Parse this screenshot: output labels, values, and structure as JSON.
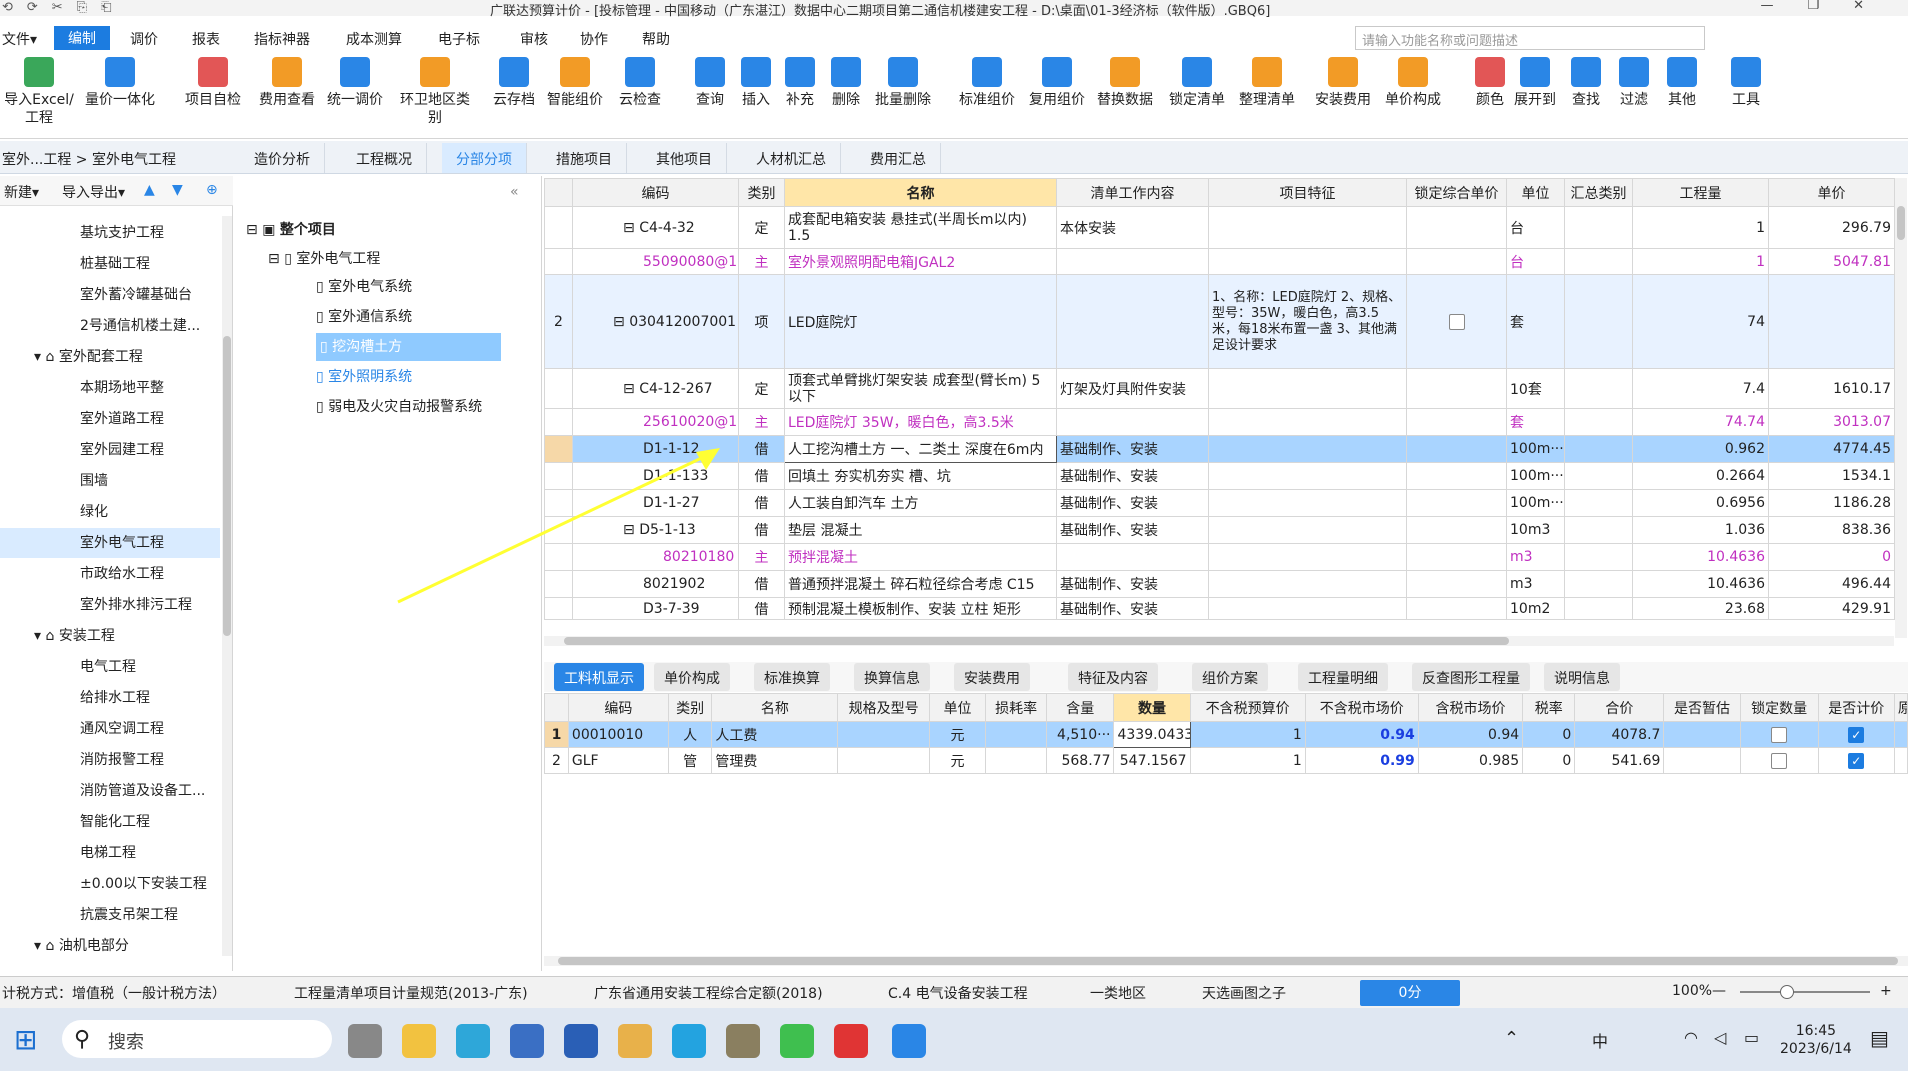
{
  "window": {
    "title": "广联达预算计价 - [投标管理 - 中国移动（广东湛江）数据中心二期项目第二通信机楼建安工程 - D:\\桌面\\01-3经济标（软件版）.GBQ6]"
  },
  "menus": [
    "文件▾",
    "编制",
    "调价",
    "报表",
    "指标神器",
    "成本测算",
    "电子标",
    "审核",
    "协作",
    "帮助"
  ],
  "search": {
    "placeholder": "请输入功能名称或问题描述"
  },
  "ribbon": [
    "导入Excel/工程",
    "量价一体化",
    "项目自检",
    "费用查看",
    "统一调价",
    "环卫地区类别",
    "云存档",
    "智能组价",
    "云检查",
    "查询",
    "插入",
    "补充",
    "删除",
    "批量删除",
    "标准组价",
    "复用组价",
    "替换数据",
    "锁定清单",
    "整理清单",
    "安装费用",
    "单价构成",
    "颜色",
    "展开到",
    "查找",
    "过滤",
    "其他",
    "工具"
  ],
  "breadcrumb": "室外...工程 > 室外电气工程",
  "tabs": [
    "造价分析",
    "工程概况",
    "分部分项",
    "措施项目",
    "其他项目",
    "人材机汇总",
    "费用汇总"
  ],
  "left": {
    "tools": [
      "新建▾",
      "导入导出▾"
    ],
    "items": [
      "基坑支护工程",
      "桩基础工程",
      "室外蓄冷罐基础台",
      "2号通信机楼土建...",
      "室外配套工程",
      "本期场地平整",
      "室外道路工程",
      "室外园建工程",
      "围墙",
      "绿化",
      "室外电气工程",
      "市政给水工程",
      "室外排水排污工程",
      "安装工程",
      "电气工程",
      "给排水工程",
      "通风空调工程",
      "消防报警工程",
      "消防管道及设备工...",
      "智能化工程",
      "电梯工程",
      "±0.00以下安装工程",
      "抗震支吊架工程",
      "油机电部分"
    ]
  },
  "tree": {
    "root": "整个项目",
    "node": "室外电气工程",
    "children": [
      "室外电气系统",
      "室外通信系统",
      "挖沟槽土方",
      "室外照明系统",
      "弱电及火灾自动报警系统"
    ]
  },
  "grid": {
    "headers": [
      "编码",
      "类别",
      "名称",
      "清单工作内容",
      "项目特征",
      "锁定综合单价",
      "单位",
      "汇总类别",
      "工程量",
      "单价"
    ],
    "rows": [
      {
        "no": "",
        "code": "C4-4-32",
        "type": "定",
        "name": "成套配电箱安装 悬挂式(半周长m以内) 1.5",
        "work": "本体安装",
        "feat": "",
        "unit": "台",
        "qty": "1",
        "price": "296.79"
      },
      {
        "no": "",
        "code": "55090080@1",
        "type": "主",
        "name": "室外景观照明配电箱JGAL2",
        "work": "",
        "feat": "",
        "unit": "台",
        "qty": "1",
        "price": "5047.81"
      },
      {
        "no": "2",
        "code": "030412007001",
        "type": "项",
        "name": "LED庭院灯",
        "work": "",
        "feat": "1、名称：LED庭院灯 2、规格、型号：35W，暖白色，高3.5米，每18米布置一盏 3、其他满足设计要求",
        "unit": "套",
        "qty": "74",
        "price": ""
      },
      {
        "no": "",
        "code": "C4-12-267",
        "type": "定",
        "name": "顶套式单臂挑灯架安装 成套型(臂长m) 5以下",
        "work": "灯架及灯具附件安装",
        "feat": "",
        "unit": "10套",
        "qty": "7.4",
        "price": "1610.17"
      },
      {
        "no": "",
        "code": "25610020@1",
        "type": "主",
        "name": "LED庭院灯 35W，暖白色，高3.5米",
        "work": "",
        "feat": "",
        "unit": "套",
        "qty": "74.74",
        "price": "3013.07"
      },
      {
        "no": "",
        "code": "D1-1-12",
        "type": "借",
        "name": "人工挖沟槽土方 一、二类土 深度在6m内",
        "work": "基础制作、安装",
        "feat": "",
        "unit": "100m···",
        "qty": "0.962",
        "price": "4774.45"
      },
      {
        "no": "",
        "code": "D1-1-133",
        "type": "借",
        "name": "回填土 夯实机夯实 槽、坑",
        "work": "基础制作、安装",
        "feat": "",
        "unit": "100m···",
        "qty": "0.2664",
        "price": "1534.1"
      },
      {
        "no": "",
        "code": "D1-1-27",
        "type": "借",
        "name": "人工装自卸汽车 土方",
        "work": "基础制作、安装",
        "feat": "",
        "unit": "100m···",
        "qty": "0.6956",
        "price": "1186.28"
      },
      {
        "no": "",
        "code": "D5-1-13",
        "type": "借",
        "name": "垫层 混凝土",
        "work": "基础制作、安装",
        "feat": "",
        "unit": "10m3",
        "qty": "1.036",
        "price": "838.36"
      },
      {
        "no": "",
        "code": "80210180",
        "type": "主",
        "name": "预拌混凝土",
        "work": "",
        "feat": "",
        "unit": "m3",
        "qty": "10.4636",
        "price": "0"
      },
      {
        "no": "",
        "code": "8021902",
        "type": "借",
        "name": "普通预拌混凝土 碎石粒径综合考虑 C15",
        "work": "基础制作、安装",
        "feat": "",
        "unit": "m3",
        "qty": "10.4636",
        "price": "496.44"
      },
      {
        "no": "",
        "code": "D3-7-39",
        "type": "借",
        "name": "预制混凝土模板制作、安装 立柱 矩形",
        "work": "基础制作、安装",
        "feat": "",
        "unit": "10m2",
        "qty": "23.68",
        "price": "429.91"
      }
    ]
  },
  "subtabs": [
    "工料机显示",
    "单价构成",
    "标准换算",
    "换算信息",
    "安装费用",
    "特征及内容",
    "组价方案",
    "工程量明细",
    "反查图形工程量",
    "说明信息"
  ],
  "sub": {
    "headers": [
      "编码",
      "类别",
      "名称",
      "规格及型号",
      "单位",
      "损耗率",
      "含量",
      "数量",
      "不含税预算价",
      "不含税市场价",
      "含税市场价",
      "税率",
      "合价",
      "是否暂估",
      "锁定数量",
      "是否计价",
      "原"
    ],
    "rows": [
      {
        "no": "1",
        "code": "00010010",
        "type": "人",
        "name": "人工费",
        "unit": "元",
        "content": "4,510···",
        "qty": "4339.0433",
        "budget": "1",
        "market": "0.94",
        "taxmarket": "0.94",
        "rate": "0",
        "total": "4078.7"
      },
      {
        "no": "2",
        "code": "GLF",
        "type": "管",
        "name": "管理费",
        "unit": "元",
        "content": "568.77",
        "qty": "547.1567",
        "budget": "1",
        "market": "0.99",
        "taxmarket": "0.985",
        "rate": "0",
        "total": "541.69"
      }
    ]
  },
  "status": [
    "计税方式：增值税（一般计税方法）",
    "工程量清单项目计量规范(2013-广东)",
    "广东省通用安装工程综合定额(2018)",
    "C.4 电气设备安装工程",
    "一类地区",
    "天选画图之子",
    "0分",
    "100%"
  ],
  "taskbar": {
    "search": "搜索",
    "time": "16:45",
    "date": "2023/6/14",
    "ime": "中"
  }
}
